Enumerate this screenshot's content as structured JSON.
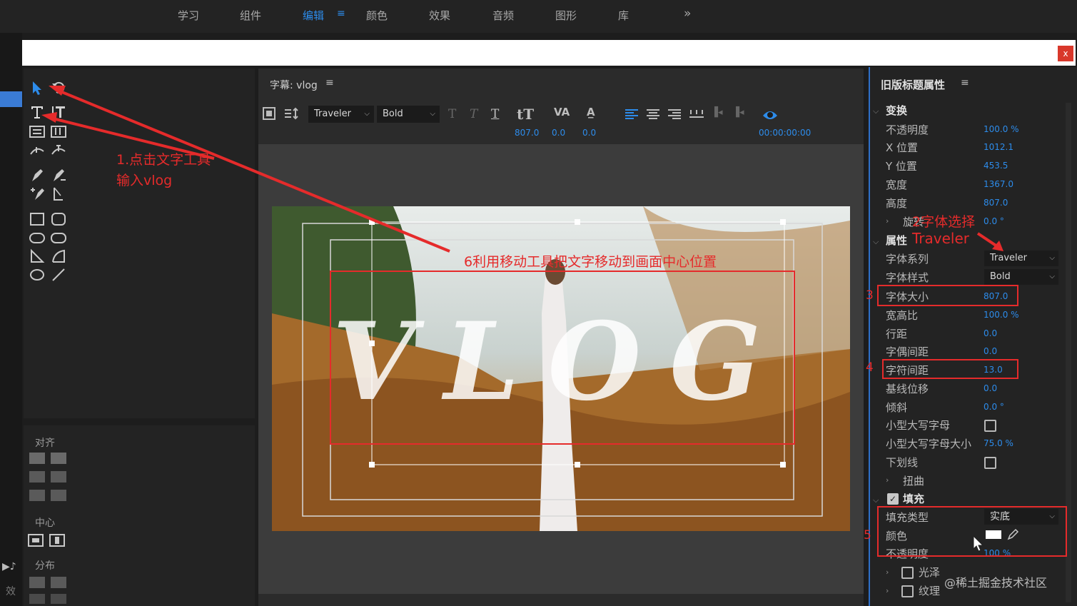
{
  "nav": {
    "items": [
      "学习",
      "组件",
      "编辑",
      "颜色",
      "效果",
      "音频",
      "图形",
      "库"
    ],
    "active_index": 2,
    "more": "»"
  },
  "close_label": "x",
  "tools": {
    "align_label": "对齐",
    "center_label": "中心",
    "distribute_label": "分布",
    "left_effect_label": "效"
  },
  "title_panel": {
    "title": "字幕: vlog",
    "font_family": "Traveler",
    "font_style": "Bold",
    "size_value": "807.0",
    "kerning_value": "0.0",
    "leading_value": "0.0",
    "timecode": "00:00:00:00",
    "canvas_text": "VLOG"
  },
  "props": {
    "header": "旧版标题属性",
    "transform_label": "变换",
    "opacity_label": "不透明度",
    "opacity_value": "100.0 %",
    "xpos_label": "X 位置",
    "xpos_value": "1012.1",
    "ypos_label": "Y 位置",
    "ypos_value": "453.5",
    "width_label": "宽度",
    "width_value": "1367.0",
    "height_label": "高度",
    "height_value": "807.0",
    "rotation_label": "旋转",
    "rotation_value": "0.0 °",
    "properties_label": "属性",
    "font_family_label": "字体系列",
    "font_family_value": "Traveler",
    "font_style_label": "字体样式",
    "font_style_value": "Bold",
    "font_size_label": "字体大小",
    "font_size_value": "807.0",
    "aspect_label": "宽高比",
    "aspect_value": "100.0 %",
    "leading_label": "行距",
    "leading_value": "0.0",
    "kerning_label": "字偶间距",
    "kerning_value": "0.0",
    "tracking_label": "字符间距",
    "tracking_value": "13.0",
    "baseline_label": "基线位移",
    "baseline_value": "0.0",
    "slant_label": "倾斜",
    "slant_value": "0.0 °",
    "smallcaps_label": "小型大写字母",
    "smallcaps_size_label": "小型大写字母大小",
    "smallcaps_size_value": "75.0 %",
    "underline_label": "下划线",
    "distort_label": "扭曲",
    "fill_label": "填充",
    "fill_type_label": "填充类型",
    "fill_type_value": "实底",
    "color_label": "颜色",
    "fill_opacity_label": "不透明度",
    "fill_opacity_value": "100 %",
    "sheen_label": "光泽",
    "texture_label": "纹理",
    "accent_color": "#2d8ceb"
  },
  "annotations": {
    "step1_line1": "1.点击文字工具",
    "step1_line2": "输入vlog",
    "step2": "2字体选择",
    "step2_font": "Traveler",
    "step3": "3",
    "step4": "4",
    "step5": "5",
    "step6": "6利用移动工具把文字移动到画面中心位置",
    "color": "#e52b2b"
  },
  "watermark": "@稀土掘金技术社区"
}
